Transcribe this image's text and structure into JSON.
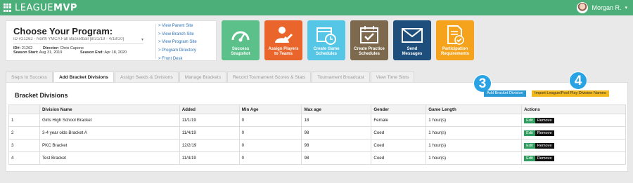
{
  "header": {
    "logo_part1": "LEAGUE",
    "logo_part2": "MVP",
    "user_name": "Morgan R.",
    "user_caret": "▾"
  },
  "program": {
    "title": "Choose Your Program:",
    "selected": "ID #21262 - North YMCA Fall Basketball [8/31/19 - 4/18/20]",
    "id_label": "ID#:",
    "id_value": "21262",
    "director_label": "Director:",
    "director_value": "Chris Capone",
    "season_start_label": "Season Start:",
    "season_start_value": "Aug 31, 2019",
    "season_end_label": "Season End:",
    "season_end_value": "Apr 18, 2020",
    "links": [
      "> View Parent Site",
      "> View Branch Site",
      "> View Program Site",
      "> Program Directory",
      "> Front Desk"
    ]
  },
  "tiles": [
    {
      "label1": "Success",
      "label2": "Snapshot",
      "color": "#5cc08a",
      "icon": "gauge-icon"
    },
    {
      "label1": "Assign Players",
      "label2": "to Teams",
      "color": "#e9652b",
      "icon": "person-check-icon"
    },
    {
      "label1": "Create Game",
      "label2": "Schedules",
      "color": "#55c6e6",
      "icon": "calendar-clock-icon"
    },
    {
      "label1": "Create Practice",
      "label2": "Schedules",
      "color": "#7d6a4e",
      "icon": "calendar-check-icon"
    },
    {
      "label1": "Send",
      "label2": "Messages",
      "color": "#1e4f7c",
      "icon": "envelope-icon"
    },
    {
      "label1": "Participation",
      "label2": "Requirements",
      "color": "#f5a21c",
      "icon": "document-check-icon"
    }
  ],
  "tabs": [
    {
      "label": "Steps to Success",
      "active": false
    },
    {
      "label": "Add Bracket Divisions",
      "active": true
    },
    {
      "label": "Assign Seeds & Divisions",
      "active": false
    },
    {
      "label": "Manage Brackets",
      "active": false
    },
    {
      "label": "Record Tournament Scores & Stats",
      "active": false
    },
    {
      "label": "Tournament Broadcast",
      "active": false
    },
    {
      "label": "View Time Slots",
      "active": false
    }
  ],
  "panel": {
    "title": "Bracket Divisions",
    "badge3": "3",
    "badge4": "4",
    "add_button": "Add Bracket Division",
    "import_button": "Import League/Pool Play Division Names"
  },
  "table": {
    "columns": [
      "",
      "Division Name",
      "Added",
      "Min Age",
      "Max age",
      "Gender",
      "Game Length",
      "Actions"
    ],
    "rows": [
      [
        "1",
        "Girls High School Bracket",
        "11/1/19",
        "0",
        "18",
        "Female",
        "1 hour(s)"
      ],
      [
        "2",
        "3-4 year olds Bracket A",
        "11/4/19",
        "0",
        "98",
        "Coed",
        "1 hour(s)"
      ],
      [
        "3",
        "PKC Bracket",
        "12/2/19",
        "0",
        "98",
        "Coed",
        "1 hour(s)"
      ],
      [
        "4",
        "Test Bracket",
        "11/4/19",
        "0",
        "98",
        "Coed",
        "1 hour(s)"
      ]
    ],
    "edit_label": "Edit",
    "remove_label": "Remove"
  }
}
